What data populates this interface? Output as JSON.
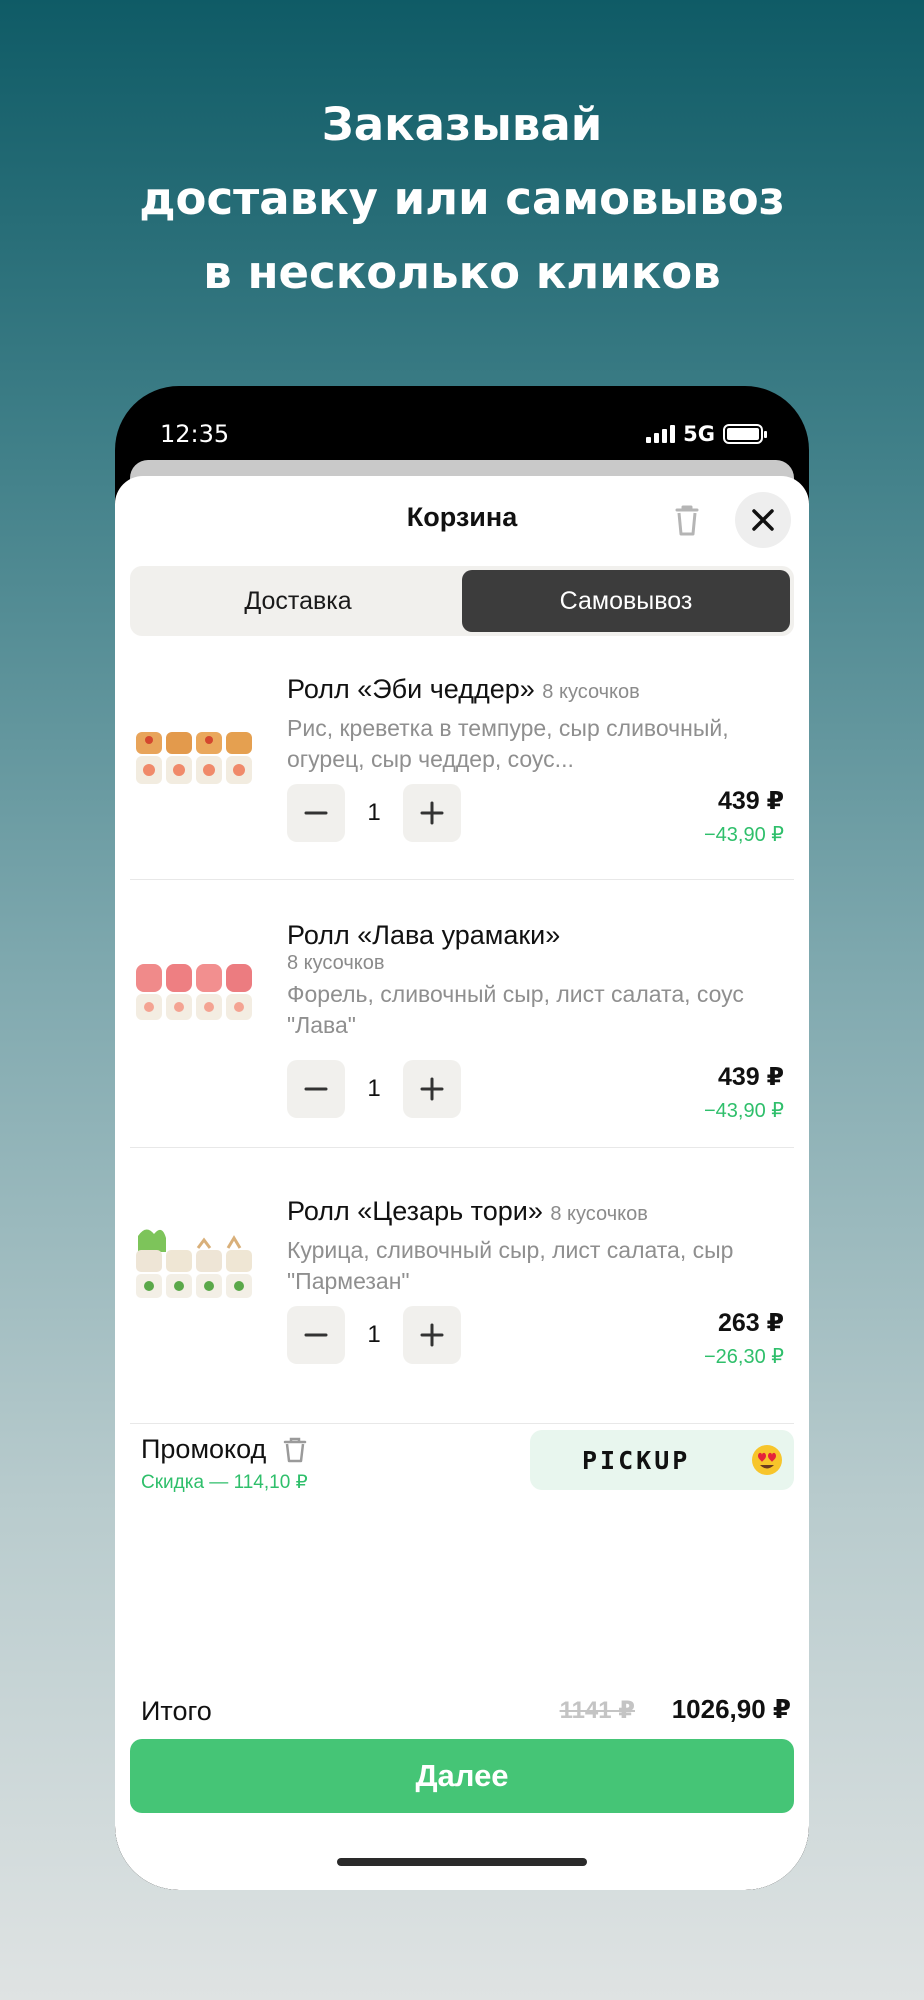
{
  "headline": {
    "line1": "Заказывай",
    "line2": "доставку или самовывоз",
    "line3": "в несколько кликов"
  },
  "status_bar": {
    "time": "12:35",
    "network": "5G"
  },
  "cart": {
    "title": "Корзина",
    "tabs": [
      {
        "label": "Доставка",
        "active": false
      },
      {
        "label": "Самовывоз",
        "active": true
      }
    ],
    "items": [
      {
        "name": "Ролл «Эби чеддер»",
        "pieces": "8 кусочков",
        "description": "Рис, креветка в темпуре, сыр сливочный, огурец, сыр чеддер, соус...",
        "quantity": "1",
        "price": "439 ₽",
        "discount": "−43,90 ₽"
      },
      {
        "name": "Ролл «Лава урамаки»",
        "pieces": "8 кусочков",
        "description": "Форель, сливочный сыр, лист салата, соус \"Лава\"",
        "quantity": "1",
        "price": "439 ₽",
        "discount": "−43,90 ₽"
      },
      {
        "name": "Ролл «Цезарь тори»",
        "pieces": "8 кусочков",
        "description": "Курица, сливочный сыр, лист салата, сыр \"Пармезан\"",
        "quantity": "1",
        "price": "263 ₽",
        "discount": "−26,30 ₽"
      }
    ],
    "promo": {
      "label": "Промокод",
      "discount": "Скидка — 114,10 ₽",
      "code": "PICKUP"
    },
    "total": {
      "label": "Итого",
      "old": "1141 ₽",
      "new": "1026,90 ₽"
    },
    "next_button": "Далее"
  },
  "colors": {
    "accent_green": "#45c576",
    "discount_green": "#2fbf6b",
    "active_tab": "#3c3c3c"
  }
}
